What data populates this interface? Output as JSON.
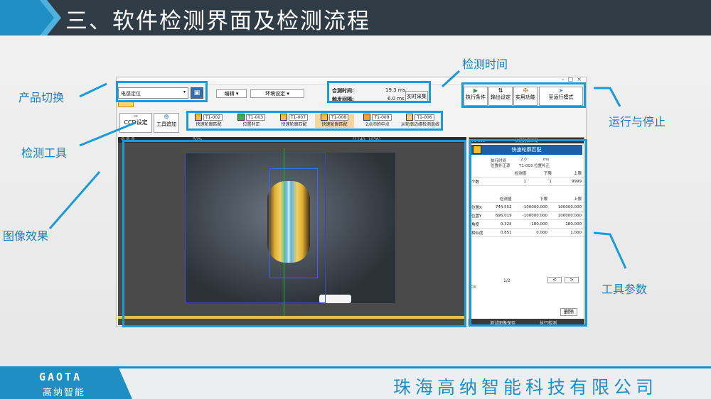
{
  "slide_title": "三、软件检测界面及检测流程",
  "annotations": {
    "product_switch": "产品切换",
    "detect_tool": "检测工具",
    "image_effect": "图像效果",
    "detect_time": "检测时间",
    "run_stop": "运行与停止",
    "tool_params": "工具参数"
  },
  "app": {
    "product_select": "电感定位",
    "menu_edit": "编辑",
    "menu_env": "环境设定",
    "total_time_label": "合测时间:",
    "total_time_value": "19.3 ms",
    "trigger_interval_label": "触发间隔:",
    "trigger_interval_value": "6.0 ms",
    "realtime_btn": "实时采集",
    "toolbar_buttons": [
      "执行条件",
      "输出设定",
      "实用功能",
      "至运行模式"
    ],
    "ccd_setting": "CCD设定",
    "tool_add": "工具追加",
    "tools": [
      {
        "id": "T1-002",
        "name": "快速轮廓匹配"
      },
      {
        "id": "T1-003",
        "name": "位置补正"
      },
      {
        "id": "T1-007",
        "name": "快速轮廓匹配"
      },
      {
        "id": "T1-008",
        "name": "快速轮廓匹配"
      },
      {
        "id": "T1-009",
        "name": "2点间的中点"
      },
      {
        "id": "T1-006",
        "name": "从轮廓边缘检测直线"
      }
    ],
    "zoom": "50%",
    "coords": "(1140, 1038)",
    "panel": {
      "tab_id": "T1-008",
      "tab_name": "快速轮廓匹配",
      "header": "快速轮廓匹配",
      "exec_time_label": "执行时间",
      "exec_time_value": "2.0",
      "exec_time_unit": "ms",
      "correction_label": "位置补正源",
      "correction_value": "T1-003 位置补正",
      "table1_headers": [
        "检测值",
        "下限",
        "上限"
      ],
      "table1_rows": [
        {
          "name": "个数",
          "values": [
            "1",
            "1",
            "9999"
          ]
        }
      ],
      "table2_headers": [
        "检测值",
        "下限",
        "上限"
      ],
      "table2_rows": [
        {
          "name": "位置X",
          "values": [
            "744.552",
            "-100000.000",
            "100000.000"
          ]
        },
        {
          "name": "位置Y",
          "values": [
            "696.019",
            "-100000.000",
            "100000.000"
          ]
        },
        {
          "name": "角度",
          "values": [
            "0.325",
            "-180.000",
            "180.000"
          ]
        },
        {
          "name": "相似度",
          "values": [
            "0.851",
            "0.000",
            "1.000"
          ]
        }
      ],
      "page": "1/2",
      "prev": "<",
      "next": ">",
      "ok_text": "OK",
      "delete_btn": "删除"
    },
    "bottom_btns": [
      "测试图像保存",
      "执行检测"
    ]
  },
  "footer": {
    "brand": "GAOTA",
    "brand_cn": "高纳智能",
    "company": "珠海高纳智能科技有限公司"
  },
  "colors": {
    "accent": "#1a9ad6",
    "header": "#2f3b45",
    "panel_blue": "#1d5fa6"
  }
}
